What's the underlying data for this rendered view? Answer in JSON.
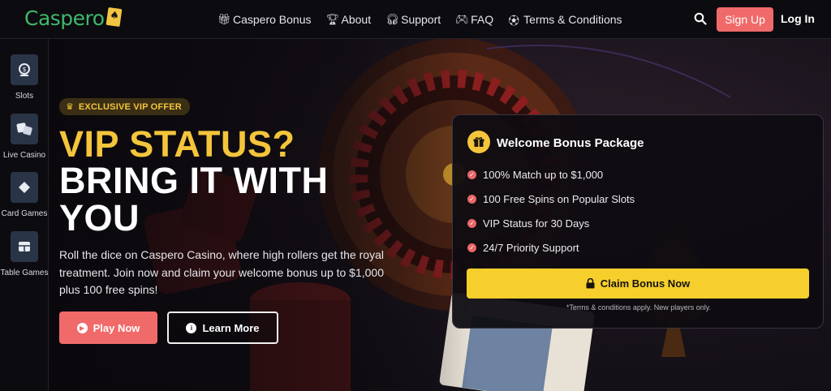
{
  "header": {
    "logo_text": "Caspero",
    "logo_card_symbol": "♠",
    "nav": [
      {
        "label": "Caspero Bonus",
        "icon": "gift-icon"
      },
      {
        "label": "About",
        "icon": "trophy-icon"
      },
      {
        "label": "Support",
        "icon": "headset-icon"
      },
      {
        "label": "FAQ",
        "icon": "gamepad-icon"
      },
      {
        "label": "Terms & Conditions",
        "icon": "soccer-ball-icon"
      }
    ],
    "signup_label": "Sign Up",
    "login_label": "Log In"
  },
  "sidebar": {
    "items": [
      {
        "label": "Slots",
        "icon": "slot-coin-icon"
      },
      {
        "label": "Live Casino",
        "icon": "dice-icon"
      },
      {
        "label": "Card Games",
        "icon": "diamond-icon"
      },
      {
        "label": "Table Games",
        "icon": "table-grid-icon"
      }
    ]
  },
  "hero": {
    "badge": "EXCLUSIVE VIP OFFER",
    "title_line1": "VIP STATUS?",
    "title_line2": "BRING IT WITH",
    "title_line3": "YOU",
    "description": "Roll the dice on Caspero Casino, where high rollers get the royal treatment. Join now and claim your welcome bonus up to $1,000 plus 100 free spins!",
    "play_label": "Play Now",
    "learn_label": "Learn More"
  },
  "bonus_card": {
    "title": "Welcome Bonus Package",
    "benefits": [
      "100% Match up to $1,000",
      "100 Free Spins on Popular Slots",
      "VIP Status for 30 Days",
      "24/7 Priority Support"
    ],
    "claim_label": "Claim Bonus Now",
    "terms": "*Terms & conditions apply. New players only."
  },
  "colors": {
    "accent_red": "#f06a6a",
    "accent_yellow": "#f4c53b",
    "logo_green": "#3fb86a"
  }
}
